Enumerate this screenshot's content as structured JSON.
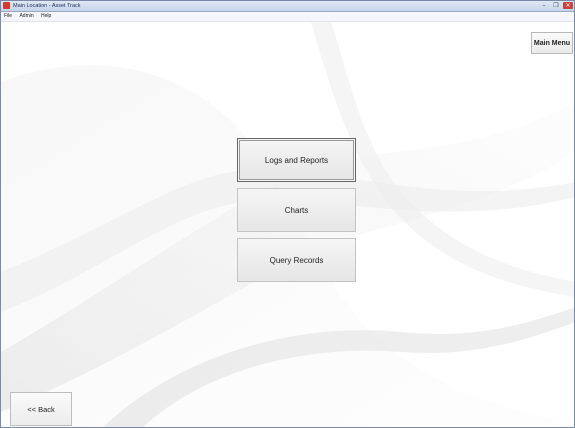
{
  "window": {
    "title": "Main Location - Asset Track",
    "controls": {
      "minimize": "–",
      "restore": "❐",
      "close": "✕"
    }
  },
  "menubar": {
    "items": [
      "File",
      "Admin",
      "Help"
    ]
  },
  "toolbar": {
    "main_menu_label": "Main Menu"
  },
  "main": {
    "buttons": [
      "Logs and Reports",
      "Charts",
      "Query Records"
    ]
  },
  "footer": {
    "back_label": "<< Back"
  }
}
